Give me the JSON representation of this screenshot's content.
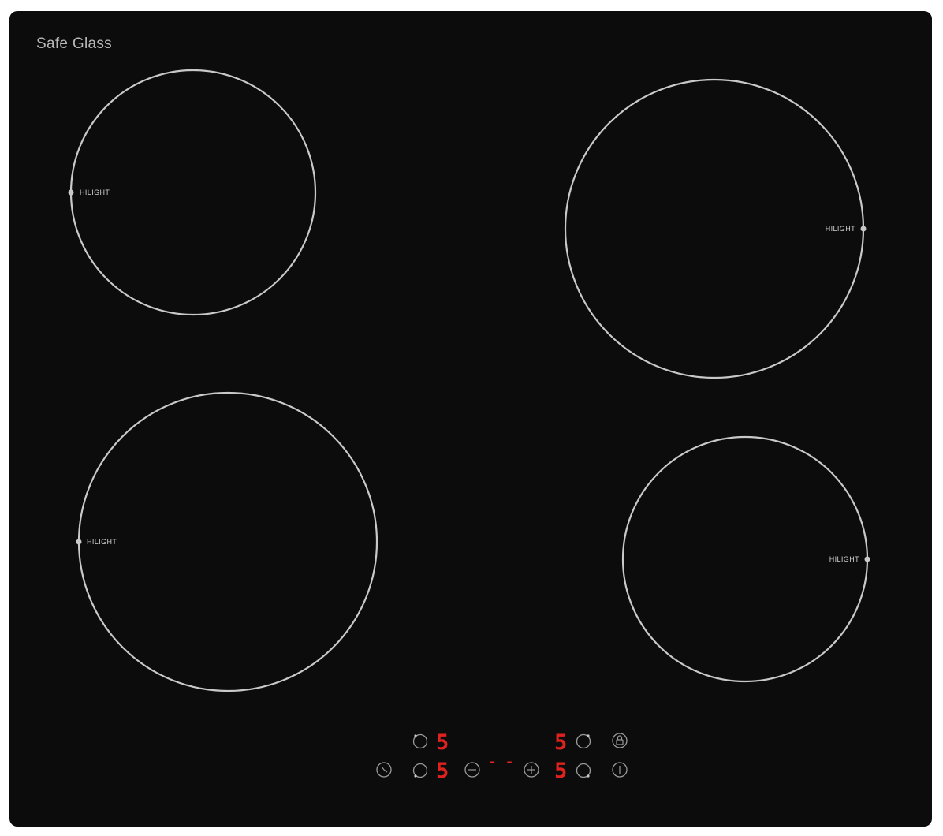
{
  "brand": "Safe Glass",
  "zones": [
    {
      "id": "rear-left",
      "label": "HILIGHT"
    },
    {
      "id": "rear-right",
      "label": "HILIGHT"
    },
    {
      "id": "front-left",
      "label": "HILIGHT"
    },
    {
      "id": "front-right",
      "label": "HILIGHT"
    }
  ],
  "controls": {
    "rear_left_level": "5",
    "rear_right_level": "5",
    "front_left_level": "5",
    "front_right_level": "5",
    "timer_display": "- -"
  },
  "icons": {
    "zone_select": "zone-select-icon",
    "timer": "timer-icon",
    "minus": "minus-icon",
    "plus": "plus-icon",
    "lock": "lock-icon",
    "power": "power-icon"
  },
  "colors": {
    "glass": "#0c0c0c",
    "markings": "#c9c9c9",
    "display": "#e0221f"
  }
}
